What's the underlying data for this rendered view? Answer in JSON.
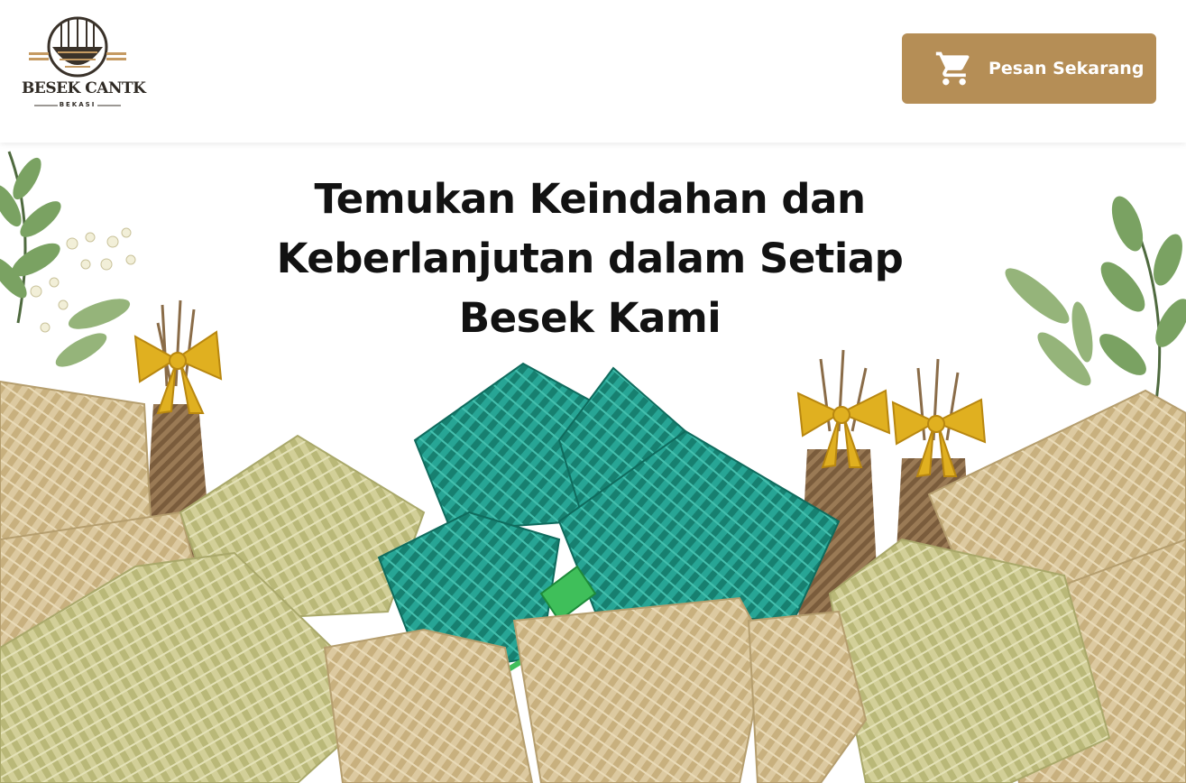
{
  "brand": {
    "name": "BESEK CANTK",
    "subtitle": "BEKASI"
  },
  "header": {
    "order_button": {
      "label": "Pesan Sekarang",
      "icon": "shopping-cart-icon"
    }
  },
  "hero": {
    "title": "Temukan Keindahan dan Keberlanjutan dalam Setiap Besek Kami",
    "image": "woven bamboo besek baskets with leaves and gold ribbons"
  },
  "colors": {
    "accent": "#b58e56",
    "text_dark": "#121212",
    "bamboo_light": "#d9c89a",
    "bamboo_green": "#c9c98a",
    "teal_weave": "#1f9a8a",
    "leaf_green": "#6f9a5a",
    "ribbon_gold": "#e0b020"
  }
}
